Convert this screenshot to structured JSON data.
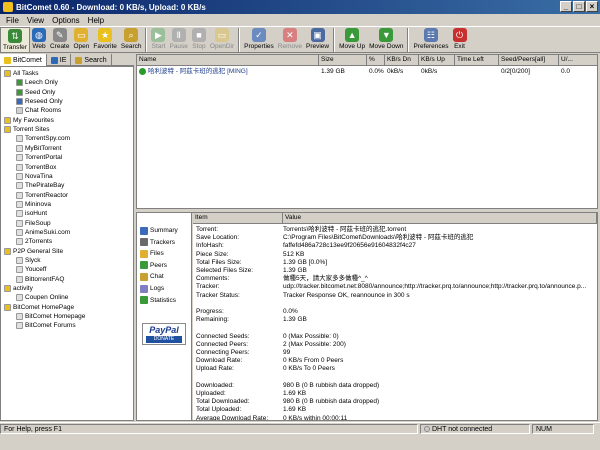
{
  "window": {
    "title": "BitComet 0.60 - Download: 0 KB/s, Upload: 0 KB/s"
  },
  "menu": [
    "File",
    "View",
    "Options",
    "Help"
  ],
  "toolbar": [
    {
      "label": "Transfer",
      "icon": "transfer-icon",
      "color": "#3a8a3a",
      "state": "active"
    },
    {
      "label": "Web",
      "icon": "globe-icon",
      "color": "#2a6ab8",
      "state": "normal"
    },
    {
      "label": "Create",
      "icon": "create-icon",
      "color": "#888888",
      "state": "normal"
    },
    {
      "label": "Open",
      "icon": "folder-icon",
      "color": "#e0b030",
      "state": "normal"
    },
    {
      "label": "Favorite",
      "icon": "star-icon",
      "color": "#e8c020",
      "state": "normal"
    },
    {
      "label": "Search",
      "icon": "search-icon",
      "color": "#c8a030",
      "state": "normal"
    },
    {
      "label": "Start",
      "icon": "play-icon",
      "color": "#9abf9a",
      "state": "disabled"
    },
    {
      "label": "Pause",
      "icon": "pause-icon",
      "color": "#b0b0b0",
      "state": "disabled"
    },
    {
      "label": "Stop",
      "icon": "stop-icon",
      "color": "#b0b0b0",
      "state": "disabled"
    },
    {
      "label": "OpenDir",
      "icon": "open-dir-icon",
      "color": "#d8c890",
      "state": "disabled"
    },
    {
      "label": "Properties",
      "icon": "properties-icon",
      "color": "#6a8ac0",
      "state": "normal"
    },
    {
      "label": "Remove",
      "icon": "remove-icon",
      "color": "#d88080",
      "state": "disabled"
    },
    {
      "label": "Preview",
      "icon": "preview-icon",
      "color": "#4a6aa0",
      "state": "normal"
    },
    {
      "label": "Move Up",
      "icon": "move-up-icon",
      "color": "#3a9a3a",
      "state": "normal"
    },
    {
      "label": "Move Down",
      "icon": "move-down-icon",
      "color": "#3a9a3a",
      "state": "normal"
    },
    {
      "label": "Preferences",
      "icon": "preferences-icon",
      "color": "#5a7ab0",
      "state": "normal"
    },
    {
      "label": "Exit",
      "icon": "exit-icon",
      "color": "#c83030",
      "state": "normal"
    }
  ],
  "left_tabs": [
    {
      "label": "BitComet",
      "color": "#e8c020"
    },
    {
      "label": "IE",
      "color": "#2a6ab8"
    },
    {
      "label": "Search",
      "color": "#c8a030"
    }
  ],
  "tree": [
    {
      "label": "All Tasks",
      "indent": 0,
      "color": "#e8c020"
    },
    {
      "label": "Leech Only",
      "indent": 1,
      "color": "#3a9a3a"
    },
    {
      "label": "Seed Only",
      "indent": 1,
      "color": "#3a9a3a"
    },
    {
      "label": "Reseed Only",
      "indent": 1,
      "color": "#3a6ab8"
    },
    {
      "label": "Chat Rooms",
      "indent": 1,
      "color": "#d0d0d0"
    },
    {
      "label": "My Favourites",
      "indent": 0,
      "color": "#e8c020"
    },
    {
      "label": "Torrent Sites",
      "indent": 0,
      "color": "#e8c020"
    },
    {
      "label": "TorrentSpy.com",
      "indent": 1,
      "color": "#e0e0e0"
    },
    {
      "label": "MyBitTorrent",
      "indent": 1,
      "color": "#e0e0e0"
    },
    {
      "label": "TorrentPortal",
      "indent": 1,
      "color": "#e0e0e0"
    },
    {
      "label": "TorrentBox",
      "indent": 1,
      "color": "#e0e0e0"
    },
    {
      "label": "NovaTina",
      "indent": 1,
      "color": "#e0e0e0"
    },
    {
      "label": "ThePirateBay",
      "indent": 1,
      "color": "#e0e0e0"
    },
    {
      "label": "TorrentReactor",
      "indent": 1,
      "color": "#e0e0e0"
    },
    {
      "label": "Mininova",
      "indent": 1,
      "color": "#e0e0e0"
    },
    {
      "label": "isoHunt",
      "indent": 1,
      "color": "#e0e0e0"
    },
    {
      "label": "FileSoup",
      "indent": 1,
      "color": "#e0e0e0"
    },
    {
      "label": "AnimeSuki.com",
      "indent": 1,
      "color": "#e0e0e0"
    },
    {
      "label": "2Torrents",
      "indent": 1,
      "color": "#e0e0e0"
    },
    {
      "label": "P2P General Site",
      "indent": 0,
      "color": "#e8c020"
    },
    {
      "label": "Slyck",
      "indent": 1,
      "color": "#e0e0e0"
    },
    {
      "label": "Youceff",
      "indent": 1,
      "color": "#e0e0e0"
    },
    {
      "label": "BittorrentFAQ",
      "indent": 1,
      "color": "#e0e0e0"
    },
    {
      "label": "activity",
      "indent": 0,
      "color": "#e8c020"
    },
    {
      "label": "Coupen Online",
      "indent": 1,
      "color": "#e0e0e0"
    },
    {
      "label": "BitComet HomePage",
      "indent": 0,
      "color": "#e8c020"
    },
    {
      "label": "BitComet Homepage",
      "indent": 1,
      "color": "#e0e0e0"
    },
    {
      "label": "BitComet Forums",
      "indent": 1,
      "color": "#e0e0e0"
    }
  ],
  "task_list": {
    "columns": [
      "Name",
      "Size",
      "%",
      "KB/s Dn",
      "KB/s Up",
      "Time Left",
      "Seed/Peers[all]",
      "U/..."
    ],
    "rows": [
      {
        "cells": [
          "哈利波特 - 阿茲卡班的逃犯 [MING]",
          "1.39 GB",
          "0.0%",
          "0kB/s",
          "0kB/s",
          "",
          "0/2[0/200]",
          "0.0"
        ]
      }
    ]
  },
  "detail_nav": [
    {
      "label": "Summary",
      "icon": "summary-icon",
      "color": "#3a6ab8"
    },
    {
      "label": "Trackers",
      "icon": "trackers-icon",
      "color": "#6a6a6a"
    },
    {
      "label": "Files",
      "icon": "files-icon",
      "color": "#e0b030"
    },
    {
      "label": "Peers",
      "icon": "peers-icon",
      "color": "#3a9a3a"
    },
    {
      "label": "Chat",
      "icon": "chat-icon",
      "color": "#c8a030"
    },
    {
      "label": "Logs",
      "icon": "logs-icon",
      "color": "#8080c0"
    },
    {
      "label": "Statistics",
      "icon": "statistics-icon",
      "color": "#3a9a3a"
    }
  ],
  "paypal": {
    "brand": "PayPal",
    "action": "DONATE"
  },
  "details": {
    "columns": [
      "Item",
      "Value"
    ],
    "rows": [
      {
        "key": "Torrent:",
        "value": "Torrents\\哈利波特 - 阿茲卡班的逃犯.torrent"
      },
      {
        "key": "Save Location:",
        "value": "C:\\Program Files\\BitComet\\Downloads\\哈利波特 - 阿茲卡班的逃犯"
      },
      {
        "key": "InfoHash:",
        "value": "faffefd486a728c13ee9f20656e91604832f4c27"
      },
      {
        "key": "Piece Size:",
        "value": "512 KB"
      },
      {
        "key": "Total Files Size:",
        "value": "1.39 GB [0.0%]"
      },
      {
        "key": "Selected Files Size:",
        "value": "1.39 GB"
      },
      {
        "key": "Comments:",
        "value": "做種5天，請大家多多做種^_^"
      },
      {
        "key": "Tracker:",
        "value": "udp://tracker.bitcomet.net:8080/announce;http://tracker.prq.to/announce;http://tracker.prq.to/announce.p..."
      },
      {
        "key": "Tracker Status:",
        "value": "Tracker Response OK, reannounce in 300 s"
      },
      {
        "key": "",
        "value": ""
      },
      {
        "key": "Progress:",
        "value": "0.0%"
      },
      {
        "key": "Remaining:",
        "value": "1.39 GB"
      },
      {
        "key": "",
        "value": ""
      },
      {
        "key": "Connected Seeds:",
        "value": "0 (Max Possible: 0)"
      },
      {
        "key": "Connected Peers:",
        "value": "2 (Max Possible: 200)"
      },
      {
        "key": "Connecting Peers:",
        "value": "99"
      },
      {
        "key": "Download Rate:",
        "value": "0 KB/s From 0 Peers"
      },
      {
        "key": "Upload Rate:",
        "value": "0 KB/s To 0 Peers"
      },
      {
        "key": "",
        "value": ""
      },
      {
        "key": "Downloaded:",
        "value": "980 B (0 B rubbish data dropped)"
      },
      {
        "key": "Uploaded:",
        "value": "1.69 KB"
      },
      {
        "key": "Total Downloaded:",
        "value": "980 B (0 B rubbish data dropped)"
      },
      {
        "key": "Total Uploaded:",
        "value": "1.69 KB"
      },
      {
        "key": "Average Download Rate:",
        "value": "0 KB/s within 00:00:11"
      }
    ]
  },
  "status": {
    "help": "For Help, press F1",
    "dht": "DHT not connected",
    "num": "NUM"
  }
}
